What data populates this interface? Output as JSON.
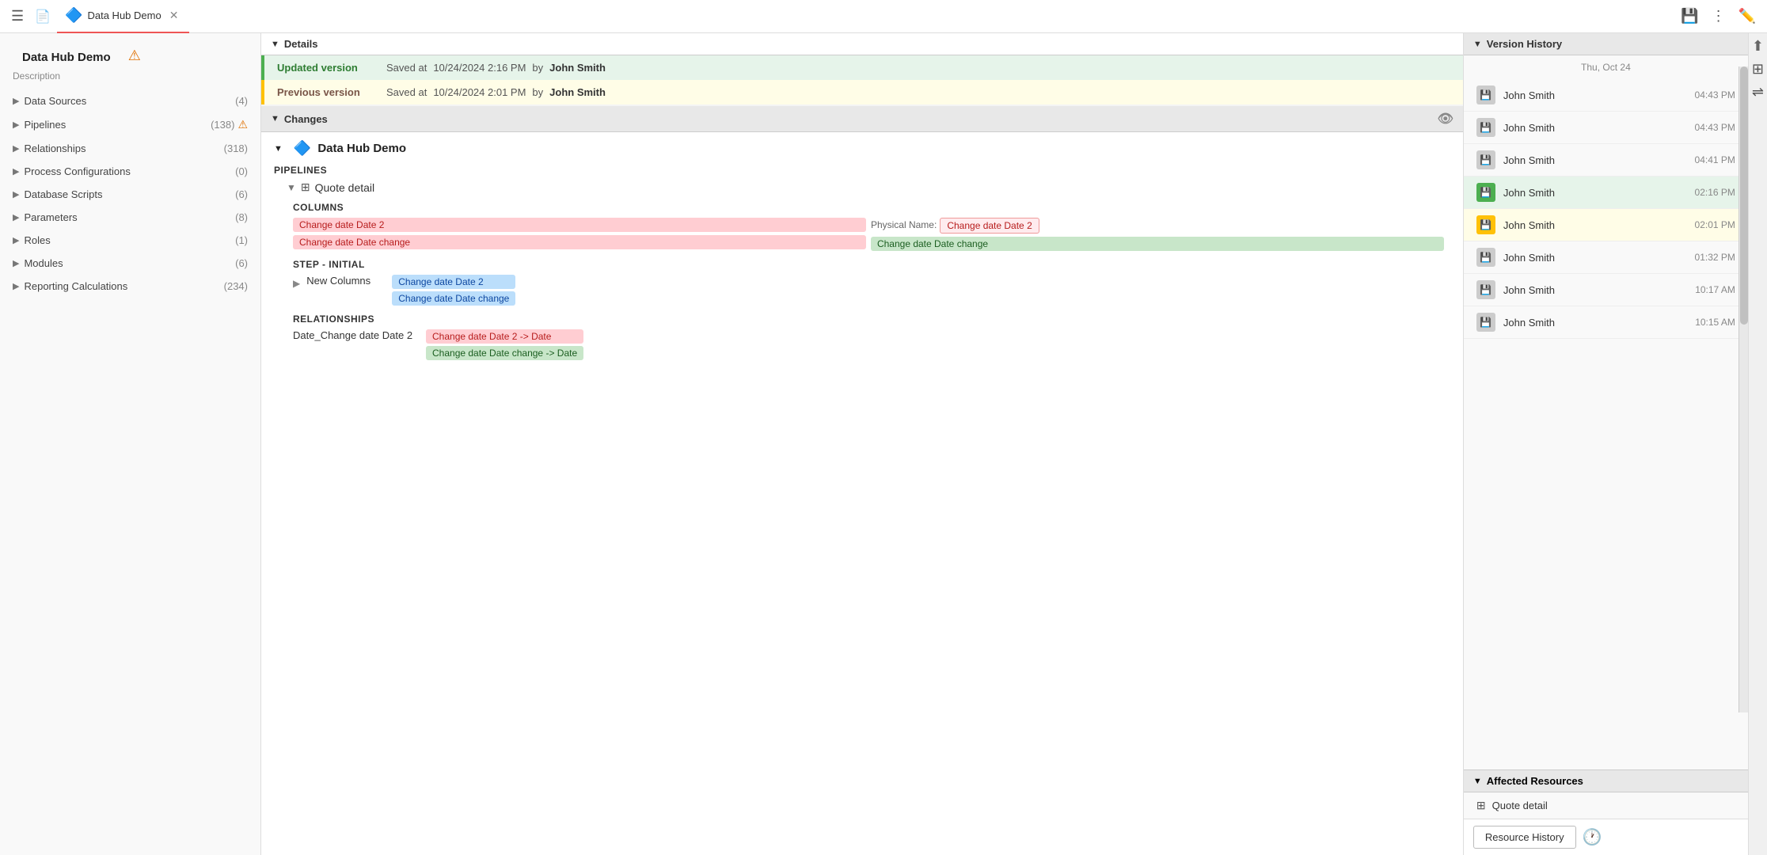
{
  "topbar": {
    "menu_icon": "☰",
    "file_icon": "📄",
    "tab_title": "Data Hub Demo",
    "tab_close": "✕",
    "save_icon": "💾",
    "more_icon": "⋮",
    "edit_icon": "✏️"
  },
  "sidebar": {
    "title": "Data Hub Demo",
    "description": "Description",
    "warning_icon": "!",
    "items": [
      {
        "label": "Data Sources",
        "count": "(4)",
        "warn": false
      },
      {
        "label": "Pipelines",
        "count": "(138)",
        "warn": true
      },
      {
        "label": "Relationships",
        "count": "(318)",
        "warn": false
      },
      {
        "label": "Process Configurations",
        "count": "(0)",
        "warn": false
      },
      {
        "label": "Database Scripts",
        "count": "(6)",
        "warn": false
      },
      {
        "label": "Parameters",
        "count": "(8)",
        "warn": false
      },
      {
        "label": "Roles",
        "count": "(1)",
        "warn": false
      },
      {
        "label": "Modules",
        "count": "(6)",
        "warn": false
      },
      {
        "label": "Reporting Calculations",
        "count": "(234)",
        "warn": false
      }
    ]
  },
  "details": {
    "section_title": "Details",
    "updated_label": "Updated version",
    "updated_saved": "Saved at",
    "updated_date": "10/24/2024 2:16 PM",
    "updated_by": "by",
    "updated_user": "John Smith",
    "previous_label": "Previous version",
    "previous_saved": "Saved at",
    "previous_date": "10/24/2024 2:01 PM",
    "previous_by": "by",
    "previous_user": "John Smith"
  },
  "changes": {
    "section_title": "Changes",
    "hide_icon": "👁",
    "hub_title": "Data Hub Demo",
    "pipelines_label": "PIPELINES",
    "pipeline_name": "Quote detail",
    "columns_label": "COLUMNS",
    "col1_tag1": "Change date Date 2",
    "col1_tag2": "Change date Date change",
    "phys_label": "Physical Name:",
    "col2_tag1": "Change date Date 2",
    "col2_tag2": "Change date Date change",
    "step_label": "STEP - Initial",
    "new_columns_label": "New Columns",
    "step_tag1": "Change date Date 2",
    "step_tag2": "Change date Date change",
    "relationships_label": "RELATIONSHIPS",
    "rel_name": "Date_Change date Date 2",
    "rel_tag1": "Change date Date 2 -> Date",
    "rel_tag2": "Change date Date change -> Date"
  },
  "version_history": {
    "section_title": "Version History",
    "date_label": "Thu, Oct 24",
    "items": [
      {
        "user": "John Smith",
        "time": "04:43 PM",
        "style": "normal"
      },
      {
        "user": "John Smith",
        "time": "04:43 PM",
        "style": "normal"
      },
      {
        "user": "John Smith",
        "time": "04:41 PM",
        "style": "normal"
      },
      {
        "user": "John Smith",
        "time": "02:16 PM",
        "style": "green"
      },
      {
        "user": "John Smith",
        "time": "02:01 PM",
        "style": "yellow"
      },
      {
        "user": "John Smith",
        "time": "01:32 PM",
        "style": "normal"
      },
      {
        "user": "John Smith",
        "time": "10:17 AM",
        "style": "normal"
      },
      {
        "user": "John Smith",
        "time": "10:15 AM",
        "style": "normal"
      }
    ]
  },
  "affected_resources": {
    "section_title": "Affected Resources",
    "items": [
      {
        "name": "Quote detail"
      }
    ]
  },
  "footer": {
    "resource_history_btn": "Resource History",
    "clock_icon": "🕐"
  }
}
